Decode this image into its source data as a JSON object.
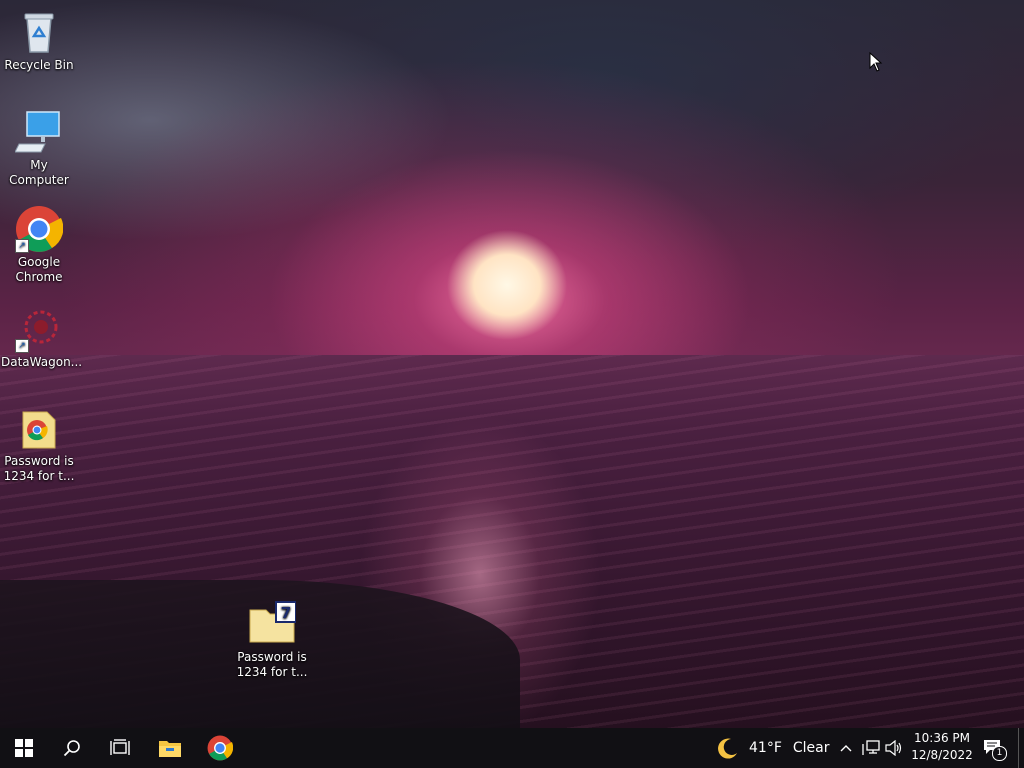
{
  "desktop": {
    "icons": [
      {
        "label": "Recycle Bin",
        "icon": "recycle-bin-icon"
      },
      {
        "label": "My Computer",
        "icon": "computer-icon"
      },
      {
        "label": "Google Chrome",
        "icon": "chrome-icon"
      },
      {
        "label": "DataWagon...",
        "icon": "datawagon-icon"
      },
      {
        "label": "Password is 1234 for t...",
        "icon": "chrome-folder-icon"
      },
      {
        "label": "Password is 1234 for t...",
        "icon": "7zip-archive-icon"
      }
    ]
  },
  "taskbar": {
    "start_icon": "windows-start-icon",
    "search_icon": "search-icon",
    "task_view_icon": "task-view-icon",
    "pinned": [
      {
        "name": "File Explorer",
        "icon": "file-explorer-icon"
      },
      {
        "name": "Google Chrome",
        "icon": "chrome-icon"
      }
    ],
    "weather": {
      "icon": "moon-icon",
      "temp": "41°F",
      "condition": "Clear"
    },
    "tray": {
      "chevron_icon": "chevron-up-icon",
      "network_icon": "network-icon",
      "volume_icon": "volume-icon"
    },
    "clock": {
      "time": "10:36 PM",
      "date": "12/8/2022"
    },
    "notifications": {
      "icon": "notification-icon",
      "count": "1"
    }
  },
  "colors": {
    "taskbar": "#111014",
    "chrome_red": "#db4437",
    "chrome_green": "#0f9d58",
    "chrome_yellow": "#f4b400",
    "chrome_blue": "#4285f4"
  }
}
